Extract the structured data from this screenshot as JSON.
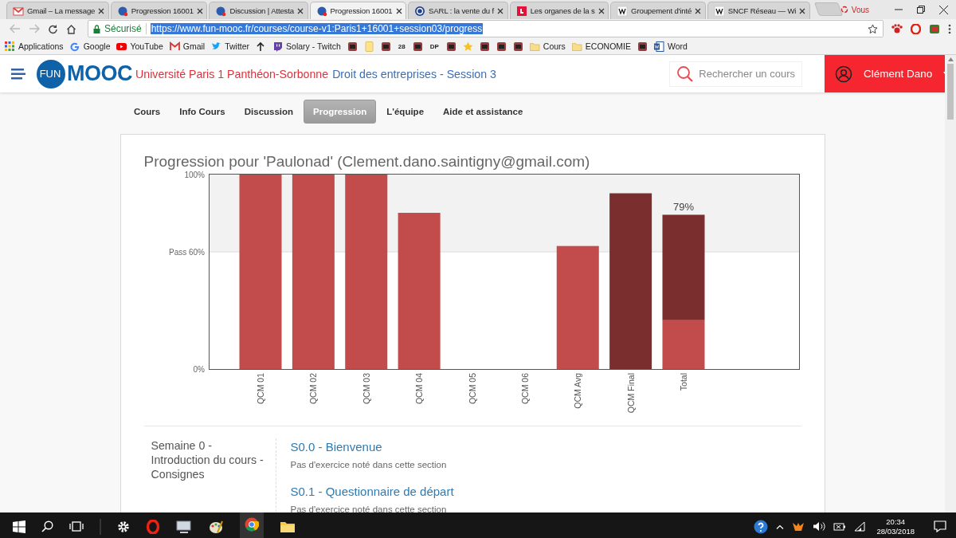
{
  "browser": {
    "tabs": [
      {
        "title": "Gmail – La message",
        "selected": false
      },
      {
        "title": "Progression 16001",
        "selected": false
      },
      {
        "title": "Discussion | Attesta",
        "selected": false
      },
      {
        "title": "Progression 16001",
        "selected": true
      },
      {
        "title": "SARL : la vente du f",
        "selected": false
      },
      {
        "title": "Les organes de la s",
        "selected": false
      },
      {
        "title": "Groupement d'inté",
        "selected": false
      },
      {
        "title": "SNCF Réseau — Wi",
        "selected": false
      }
    ],
    "profile": "Vous",
    "address": {
      "security": "Sécurisé",
      "url": "https://www.fun-mooc.fr/courses/course-v1:Paris1+16001+session03/progress",
      "selected": true
    },
    "bookmarks": [
      {
        "kind": "apps",
        "label": "Applications"
      },
      {
        "kind": "google",
        "label": "Google"
      },
      {
        "kind": "youtube",
        "label": "YouTube"
      },
      {
        "kind": "gmail",
        "label": "Gmail"
      },
      {
        "kind": "twitter",
        "label": "Twitter"
      },
      {
        "kind": "arrow"
      },
      {
        "kind": "twitch",
        "label": "Solary - Twitch"
      },
      {
        "kind": "icon"
      },
      {
        "kind": "note"
      },
      {
        "kind": "icon"
      },
      {
        "kind": "badge",
        "label": "28"
      },
      {
        "kind": "icon"
      },
      {
        "kind": "badge",
        "label": "DP"
      },
      {
        "kind": "icon"
      },
      {
        "kind": "star"
      },
      {
        "kind": "icon"
      },
      {
        "kind": "icon"
      },
      {
        "kind": "icon"
      },
      {
        "kind": "folder",
        "label": "Cours"
      },
      {
        "kind": "folder",
        "label": "ECONOMIE"
      },
      {
        "kind": "icon"
      },
      {
        "kind": "word",
        "label": "Word"
      }
    ]
  },
  "header": {
    "logo": {
      "fun": "FUN",
      "mooc": "MOOC"
    },
    "university": "Université Paris 1 Panthéon-Sorbonne",
    "course": "Droit des entreprises - Session 3",
    "search": {
      "placeholder": "Rechercher un cours"
    },
    "user": "Clément Dano"
  },
  "course_nav": [
    {
      "label": "Cours",
      "selected": false
    },
    {
      "label": "Info Cours",
      "selected": false
    },
    {
      "label": "Discussion",
      "selected": false
    },
    {
      "label": "Progression",
      "selected": true
    },
    {
      "label": "L'équipe",
      "selected": false
    },
    {
      "label": "Aide et assistance",
      "selected": false
    }
  ],
  "progress": {
    "title": "Progression pour 'Paulonad' (Clement.dano.saintigny@gmail.com)",
    "chart_data": {
      "type": "bar",
      "categories": [
        "QCM 01",
        "QCM 02",
        "QCM 03",
        "QCM 04",
        "QCM 05",
        "QCM 06",
        "QCM Avg",
        "QCM Final",
        "Total"
      ],
      "series": [
        {
          "color": "#c24b4b",
          "values": [
            100,
            100,
            100,
            80,
            0,
            0,
            63,
            null,
            25
          ]
        },
        {
          "color": "#7b2e2e",
          "values": [
            null,
            null,
            null,
            null,
            null,
            null,
            null,
            90,
            54
          ]
        }
      ],
      "stacked": true,
      "ylim": [
        0,
        100
      ],
      "yticks": [
        {
          "value": 0,
          "label": "0%"
        },
        {
          "value": 60,
          "label": "Pass 60%"
        },
        {
          "value": 100,
          "label": "100%"
        }
      ],
      "annotations": [
        {
          "x": "Total",
          "y": 79,
          "text": "79%"
        }
      ]
    },
    "sections": [
      {
        "chapter": "Semaine 0 - Introduction du cours - Consignes",
        "subsections": [
          {
            "title": "S0.0 - Bienvenue",
            "note": "Pas d'exercice noté dans cette section"
          },
          {
            "title": "S0.1 - Questionnaire de départ",
            "note": "Pas d'exercice noté dans cette section"
          }
        ]
      }
    ]
  },
  "taskbar": {
    "time": "20:34",
    "date": "28/03/2018"
  }
}
